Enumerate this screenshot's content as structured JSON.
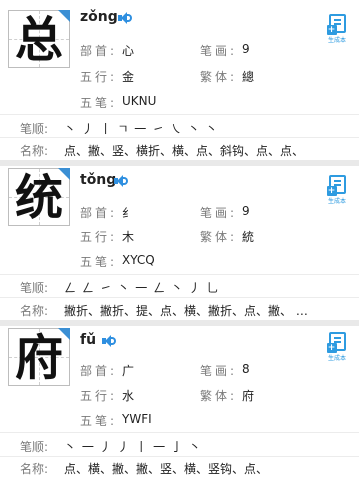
{
  "labels": {
    "bushou": "部首:",
    "bihua": "笔画:",
    "wuxing": "五行:",
    "fanti": "繁体:",
    "wubi": "五笔:",
    "bishun": "笔顺:",
    "mingcheng": "名称:",
    "generate": "生成本"
  },
  "colors": {
    "accent": "#2e8fe0",
    "divider": "#e9e9e9",
    "label": "#7a7a7a"
  },
  "entries": [
    {
      "char": "总",
      "pinyin": "zǒng",
      "radical": "心",
      "strokes": "9",
      "wuxing": "金",
      "traditional": "總",
      "wubi": "UKNU",
      "stroke_order": "丶 丿 丨 ㄱ 一 ㇀ ㇏ 丶 丶",
      "stroke_names": "点、撇、竖、横折、横、点、斜钩、点、点、"
    },
    {
      "char": "统",
      "pinyin": "tǒng",
      "radical": "纟",
      "strokes": "9",
      "wuxing": "木",
      "traditional": "統",
      "wubi": "XYCQ",
      "stroke_order": "ㄥ ㄥ ㇀ 丶 一 ㄥ 丶 丿 乚",
      "stroke_names": "撇折、撇折、提、点、横、撇折、点、撇、 …"
    },
    {
      "char": "府",
      "pinyin": "fǔ",
      "radical": "广",
      "strokes": "8",
      "wuxing": "水",
      "traditional": "府",
      "wubi": "YWFI",
      "stroke_order": "丶 一 丿 丿 丨 一 亅 丶",
      "stroke_names": "点、横、撇、撇、竖、横、竖钩、点、"
    }
  ]
}
